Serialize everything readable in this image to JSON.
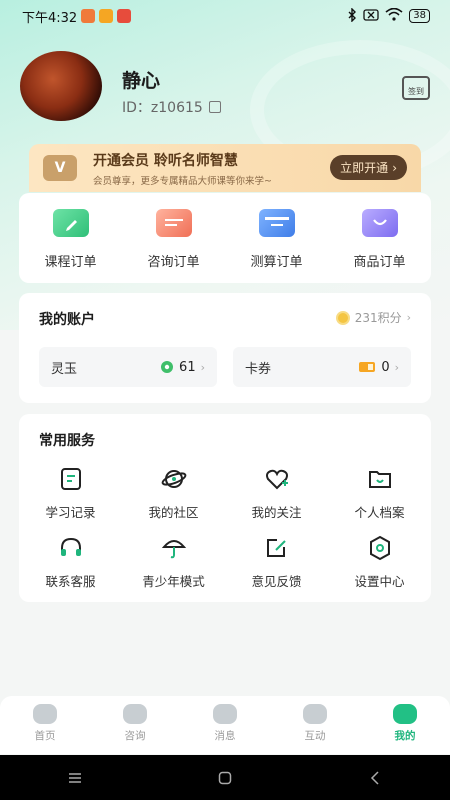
{
  "status_bar": {
    "time": "下午4:32",
    "battery": "38",
    "app_icon_colors": [
      "#f07a3a",
      "#f5a623",
      "#e74c3c"
    ]
  },
  "profile": {
    "name": "静心",
    "id_text": "ID：z10615",
    "checkin_label": "签到"
  },
  "vip": {
    "badge": "V",
    "title": "开通会员  聆听名师智慧",
    "subtitle": "会员尊享，更多专属精品大师课等你来学~",
    "button": "立即开通"
  },
  "orders": [
    {
      "label": "课程订单",
      "icon": "course-order-icon",
      "color": "#3fcf87"
    },
    {
      "label": "咨询订单",
      "icon": "consult-order-icon",
      "color": "#f2826a"
    },
    {
      "label": "测算订单",
      "icon": "calc-order-icon",
      "color": "#4d8ef3"
    },
    {
      "label": "商品订单",
      "icon": "goods-order-icon",
      "color": "#8e7cf0"
    }
  ],
  "account": {
    "title": "我的账户",
    "points": "231积分",
    "lingyu_label": "灵玉",
    "lingyu_value": "61",
    "coupon_label": "卡券",
    "coupon_value": "0"
  },
  "services": {
    "title": "常用服务",
    "items": [
      {
        "label": "学习记录",
        "icon": "study-record-icon"
      },
      {
        "label": "我的社区",
        "icon": "community-icon"
      },
      {
        "label": "我的关注",
        "icon": "follow-heart-icon"
      },
      {
        "label": "个人档案",
        "icon": "profile-folder-icon"
      },
      {
        "label": "联系客服",
        "icon": "headset-icon"
      },
      {
        "label": "青少年模式",
        "icon": "umbrella-icon"
      },
      {
        "label": "意见反馈",
        "icon": "feedback-icon"
      },
      {
        "label": "设置中心",
        "icon": "settings-hex-icon"
      }
    ]
  },
  "tabs": [
    {
      "label": "首页",
      "active": false
    },
    {
      "label": "咨询",
      "active": false
    },
    {
      "label": "消息",
      "active": false
    },
    {
      "label": "互动",
      "active": false
    },
    {
      "label": "我的",
      "active": true
    }
  ],
  "colors": {
    "accent": "#22c085",
    "vip_button": "#5a3f29"
  }
}
